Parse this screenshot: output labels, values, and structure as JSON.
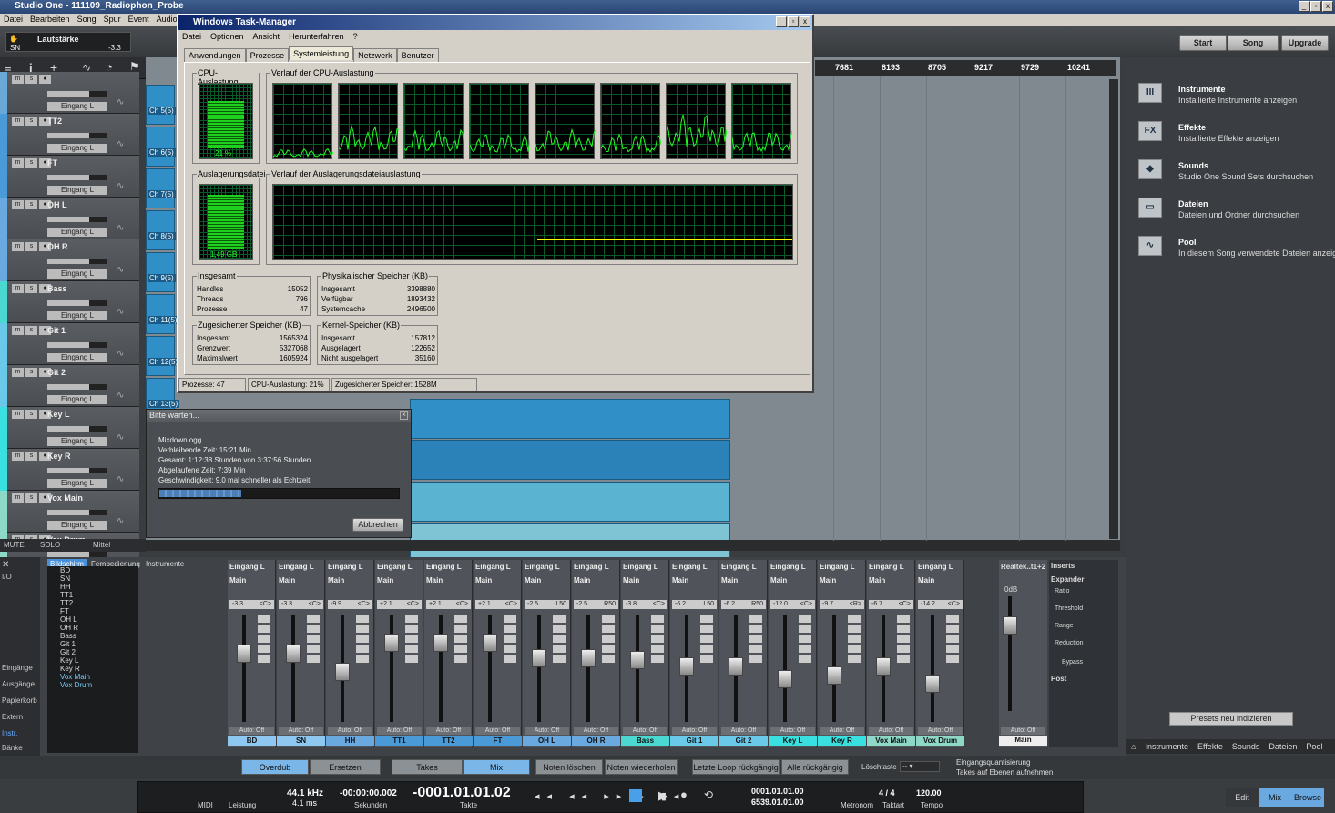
{
  "app": {
    "title": "Studio One - 111109_Radiophon_Probe",
    "menus": [
      "Datei",
      "Bearbeiten",
      "Song",
      "Spur",
      "Event",
      "Audio"
    ],
    "window_buttons": [
      "_",
      "▫",
      "x"
    ]
  },
  "toolbar": {
    "track_name": "Lautstärke",
    "track_short": "SN",
    "volume": "-3.3",
    "buttons": [
      "Start",
      "Song",
      "Upgrade"
    ],
    "ruler_ticks": [
      "7681",
      "8193",
      "8705",
      "9217",
      "9729",
      "10241"
    ]
  },
  "tracks": [
    {
      "name": "",
      "input": "Eingang L"
    },
    {
      "name": "TT2",
      "input": "Eingang L"
    },
    {
      "name": "FT",
      "input": "Eingang L"
    },
    {
      "name": "OH L",
      "input": "Eingang L"
    },
    {
      "name": "OH R",
      "input": "Eingang L"
    },
    {
      "name": "Bass",
      "input": "Eingang L"
    },
    {
      "name": "Git 1",
      "input": "Eingang L"
    },
    {
      "name": "Git 2",
      "input": "Eingang L"
    },
    {
      "name": "Key L",
      "input": "Eingang L"
    },
    {
      "name": "Key R",
      "input": "Eingang L"
    },
    {
      "name": "Vox Main",
      "input": "Eingang L"
    },
    {
      "name": "Vox Drum",
      "input": ""
    }
  ],
  "track_footer": {
    "mute": "MUTE",
    "solo": "SOLO",
    "mode": "Mittel"
  },
  "channel_labels": [
    "Ch 5(5)",
    "Ch 6(5)",
    "Ch 7(5)",
    "Ch 8(5)",
    "Ch 9(5)",
    "Ch 11(5)",
    "Ch 12(5)",
    "Ch 13(5)"
  ],
  "taskmanager": {
    "title": "Windows Task-Manager",
    "menus": [
      "Datei",
      "Optionen",
      "Ansicht",
      "Herunterfahren",
      "?"
    ],
    "tabs": [
      "Anwendungen",
      "Prozesse",
      "Systemleistung",
      "Netzwerk",
      "Benutzer"
    ],
    "cpu_label": "CPU-Auslastung",
    "cpu_value": "21 %",
    "cpu_history": "Verlauf der CPU-Auslastung",
    "page_label": "Auslagerungsdatei",
    "page_value": "1,49 GB",
    "page_history": "Verlauf der Auslagerungsdateiauslastung",
    "totals": {
      "label": "Insgesamt",
      "rows": [
        [
          "Handles",
          "15052"
        ],
        [
          "Threads",
          "796"
        ],
        [
          "Prozesse",
          "47"
        ]
      ]
    },
    "physical": {
      "label": "Physikalischer Speicher (KB)",
      "rows": [
        [
          "Insgesamt",
          "3398880"
        ],
        [
          "Verfügbar",
          "1893432"
        ],
        [
          "Systemcache",
          "2496500"
        ]
      ]
    },
    "commit": {
      "label": "Zugesicherter Speicher (KB)",
      "rows": [
        [
          "Insgesamt",
          "1565324"
        ],
        [
          "Grenzwert",
          "5327068"
        ],
        [
          "Maximalwert",
          "1605924"
        ]
      ]
    },
    "kernel": {
      "label": "Kernel-Speicher (KB)",
      "rows": [
        [
          "Insgesamt",
          "157812"
        ],
        [
          "Ausgelagert",
          "122652"
        ],
        [
          "Nicht ausgelagert",
          "35160"
        ]
      ]
    },
    "status": [
      "Prozesse: 47",
      "CPU-Auslastung: 21%",
      "Zugesicherter Speicher: 1528M"
    ]
  },
  "wait_dialog": {
    "title": "Bitte warten...",
    "file": "Mixdown.ogg",
    "lines": [
      "Verbleibende Zeit:   15:21 Min",
      "Gesamt: 1:12:38 Stunden von 3:37:56 Stunden",
      "Abgelaufene Zeit: 7:39 Min",
      "Geschwindigkeit: 9.0 mal schneller als Echtzeit"
    ],
    "progress": 0.34,
    "cancel": "Abbrechen"
  },
  "browser": {
    "items": [
      {
        "icon": "III",
        "title": "Instrumente",
        "desc": "Installierte Instrumente anzeigen"
      },
      {
        "icon": "FX",
        "title": "Effekte",
        "desc": "Installierte Effekte anzeigen"
      },
      {
        "icon": "◆",
        "title": "Sounds",
        "desc": "Studio One Sound Sets durchsuchen"
      },
      {
        "icon": "▭",
        "title": "Dateien",
        "desc": "Dateien und Ordner durchsuchen"
      },
      {
        "icon": "∿",
        "title": "Pool",
        "desc": "In diesem Song verwendete Dateien anzeigen"
      }
    ],
    "presets_button": "Presets neu indizieren",
    "tabs": [
      "Instrumente",
      "Effekte",
      "Sounds",
      "Dateien",
      "Pool"
    ]
  },
  "mixer": {
    "left_labels": [
      "I/O",
      "Eingänge",
      "Ausgänge",
      "Papierkorb",
      "Extern",
      "Instr.",
      "Bänke"
    ],
    "panel_tabs": [
      "Bildschirm",
      "Fernbedienung",
      "Instrumente"
    ],
    "instruments": [
      "BD",
      "SN",
      "HH",
      "TT1",
      "TT2",
      "FT",
      "OH L",
      "OH R",
      "Bass",
      "Git 1",
      "Git 2",
      "Key L",
      "Key R",
      "Vox Main",
      "Vox Drum"
    ],
    "channels": [
      {
        "name": "BD",
        "input": "Eingang L",
        "output": "Main",
        "vol": "-3.3",
        "pan": "<C>",
        "color": "#8ec8f0",
        "level": 0.72
      },
      {
        "name": "SN",
        "input": "Eingang L",
        "output": "Main",
        "vol": "-3.3",
        "pan": "<C>",
        "color": "#8ec8f0",
        "level": 0.72
      },
      {
        "name": "HH",
        "input": "Eingang L",
        "output": "Main",
        "vol": "-9.9",
        "pan": "<C>",
        "color": "#6aa8e0",
        "level": 0.55
      },
      {
        "name": "TT1",
        "input": "Eingang L",
        "output": "Main",
        "vol": "+2.1",
        "pan": "<C>",
        "color": "#4a9ad8",
        "level": 0.82
      },
      {
        "name": "TT2",
        "input": "Eingang L",
        "output": "Main",
        "vol": "+2.1",
        "pan": "<C>",
        "color": "#4a9ad8",
        "level": 0.82
      },
      {
        "name": "FT",
        "input": "Eingang L",
        "output": "Main",
        "vol": "+2.1",
        "pan": "<C>",
        "color": "#4a9ad8",
        "level": 0.82
      },
      {
        "name": "OH L",
        "input": "Eingang L",
        "output": "Main",
        "vol": "-2.5",
        "pan": "L50",
        "color": "#6aa8e0",
        "level": 0.68
      },
      {
        "name": "OH R",
        "input": "Eingang L",
        "output": "Main",
        "vol": "-2.5",
        "pan": "R50",
        "color": "#6aa8e0",
        "level": 0.68
      },
      {
        "name": "Bass",
        "input": "Eingang L",
        "output": "Main",
        "vol": "-3.8",
        "pan": "<C>",
        "color": "#4ad8d0",
        "level": 0.66
      },
      {
        "name": "Git 1",
        "input": "Eingang L",
        "output": "Main",
        "vol": "-6.2",
        "pan": "L50",
        "color": "#6ac8e8",
        "level": 0.6
      },
      {
        "name": "Git 2",
        "input": "Eingang L",
        "output": "Main",
        "vol": "-6.2",
        "pan": "R50",
        "color": "#6ac8e8",
        "level": 0.6
      },
      {
        "name": "Key L",
        "input": "Eingang L",
        "output": "Main",
        "vol": "-12.0",
        "pan": "<C>",
        "color": "#3ae0e0",
        "level": 0.48
      },
      {
        "name": "Key R",
        "input": "Eingang L",
        "output": "Main",
        "vol": "-9.7",
        "pan": "<R>",
        "color": "#3ae0e0",
        "level": 0.52
      },
      {
        "name": "Vox Main",
        "input": "Eingang L",
        "output": "Main",
        "vol": "-6.7",
        "pan": "<C>",
        "color": "#8ed8c8",
        "level": 0.6
      },
      {
        "name": "Vox Drum",
        "input": "Eingang L",
        "output": "Main",
        "vol": "-14.2",
        "pan": "<C>",
        "color": "#8ed8c8",
        "level": 0.44
      }
    ],
    "automation": "Auto: Off",
    "main": {
      "name": "Main",
      "label": "Realtek..t1+2",
      "vol": "0dB"
    },
    "inserts": {
      "title": "Inserts",
      "plugin": "Expander",
      "params": [
        "Ratio",
        "Threshold",
        "Range",
        "Reduction"
      ],
      "bypass": "Bypass",
      "post": "Post"
    }
  },
  "modes": {
    "record": [
      "Overdub",
      "Ersetzen"
    ],
    "takes": [
      "Takes",
      "Mix"
    ],
    "notes": [
      "Noten löschen",
      "Noten wiederholen"
    ],
    "loop": [
      "Letzte Loop rückgängig",
      "Alle rückgängig"
    ],
    "erase_label": "Löschtaste",
    "quant": [
      "Eingangsquantisierung",
      "Takes auf Ebenen aufnehmen"
    ]
  },
  "transport": {
    "midi": "MIDI",
    "leistung": "Leistung",
    "rate": "44.1 kHz",
    "latency": "4.1 ms",
    "seconds": "-00:00:00.002",
    "seconds_lbl": "Sekunden",
    "bars": "-0001.01.01.02",
    "bars_lbl": "Takte",
    "loop_start": "0001.01.01.00",
    "loop_end": "6539.01.01.00",
    "metronome": "Metronom",
    "signature": "4 / 4",
    "sig_lbl": "Taktart",
    "tempo": "120.00",
    "tempo_lbl": "Tempo"
  },
  "views": [
    "Edit",
    "Mix",
    "Browse"
  ]
}
